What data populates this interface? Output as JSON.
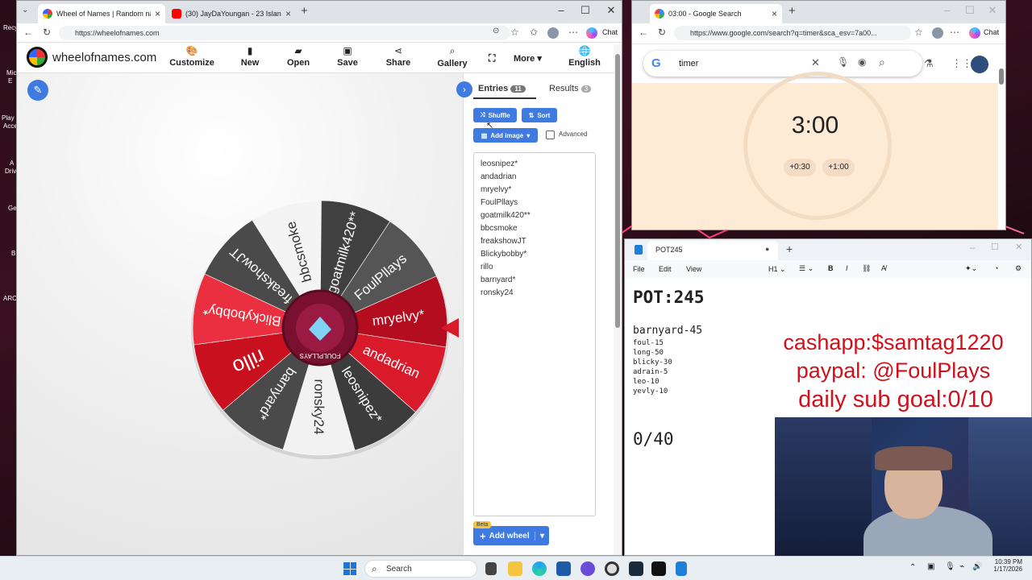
{
  "desktop": {
    "icon_labels": [
      "Recy",
      "Mic",
      "E",
      "Play",
      "Acce",
      "A",
      "Driv",
      "Ge",
      "B",
      "ARC"
    ]
  },
  "browser1": {
    "tabs": [
      {
        "label": "Wheel of Names | Random name p"
      },
      {
        "label": "(30) JayDaYoungan - 23 Island [Offi"
      }
    ],
    "url": "https://wheelofnames.com",
    "chat_label": "Chat",
    "site": {
      "logo_text": "wheelofnames.com",
      "menu": [
        {
          "label": "Customize",
          "icon": "palette-icon"
        },
        {
          "label": "New",
          "icon": "file-icon"
        },
        {
          "label": "Open",
          "icon": "folder-icon"
        },
        {
          "label": "Save",
          "icon": "floppy-icon"
        },
        {
          "label": "Share",
          "icon": "share-icon"
        },
        {
          "label": "Gallery",
          "icon": "search-icon"
        }
      ],
      "more_label": "More",
      "language_label": "English"
    },
    "wheel": {
      "segments": [
        {
          "label": "mryelvy*",
          "color": "#b40d1f"
        },
        {
          "label": "andadrian",
          "color": "#d91a2a"
        },
        {
          "label": "leosnipez*",
          "color": "#3c3c3c"
        },
        {
          "label": "ronsky24",
          "color": "#f2f2f2"
        },
        {
          "label": "barnyard*",
          "color": "#4a4a4a"
        },
        {
          "label": "rillo",
          "color": "#c8101f"
        },
        {
          "label": "Blickybobby*",
          "color": "#ea3040"
        },
        {
          "label": "freakshowJT",
          "color": "#4a4a4a"
        },
        {
          "label": "bbcsmoke",
          "color": "#f4f4f4"
        },
        {
          "label": "goatmilk420**",
          "color": "#404040"
        },
        {
          "label": "FoulPllays",
          "color": "#555555"
        }
      ],
      "center_text": "FOULPLLAYS"
    },
    "panel": {
      "entries_tab": "Entries",
      "entries_count": "11",
      "results_tab": "Results",
      "results_count": "3",
      "shuffle": "Shuffle",
      "sort": "Sort",
      "add_image": "Add image",
      "advanced": "Advanced",
      "entries": [
        "leosnipez*",
        "andadrian",
        "mryelvy*",
        "FoulPllays",
        "goatmilk420**",
        "bbcsmoke",
        "freakshowJT",
        "Blickybobby*",
        "rillo",
        "barnyard*",
        "ronsky24"
      ],
      "beta": "Beta",
      "add_wheel": "Add wheel"
    }
  },
  "browser2": {
    "tab_label": "03:00 - Google Search",
    "url": "https://www.google.com/search?q=timer&sca_esv=7a00...",
    "chat_label": "Chat",
    "search_query": "timer",
    "timer": "3:00",
    "add30": "+0:30",
    "add60": "+1:00"
  },
  "notepad": {
    "tab_label": "POT245",
    "menu": [
      "File",
      "Edit",
      "View"
    ],
    "heading_select": "H1",
    "pot": "POT:245",
    "first_line": "barnyard-45",
    "lines": [
      "foul-15",
      "long-50",
      "blicky-30",
      "adrain-5",
      "leo-10",
      "yevly-10"
    ],
    "counter": "0/40"
  },
  "stream_overlay": {
    "cashapp": "cashapp:$samtag1220",
    "paypal": "paypal: @FoulPlays",
    "goal": "daily sub goal:0/10"
  },
  "taskbar": {
    "search": "Search",
    "time": "10:39 PM",
    "date": "1/17/2026"
  }
}
